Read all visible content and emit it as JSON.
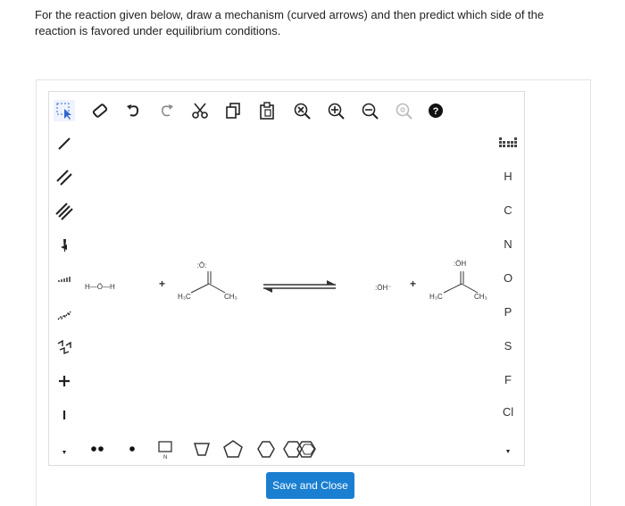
{
  "question": {
    "line1": "For the reaction given below, draw a mechanism (curved arrows) and then predict which side of the",
    "line2": "reaction is favored under equilibrium conditions."
  },
  "toolbar_top": [
    "select-icon",
    "eraser-icon",
    "undo-icon",
    "redo-icon",
    "cut-icon",
    "copy-icon",
    "paste-icon",
    "zoom-fit-icon",
    "zoom-in-icon",
    "zoom-out-icon",
    "zoom-reset-icon",
    "help-icon"
  ],
  "toolbar_left": [
    "single-bond-icon",
    "double-bond-icon",
    "triple-bond-icon",
    "wedge-bond-icon",
    "hash-bond-icon",
    "wavy-bond-icon",
    "chain-icon",
    "positive-charge-icon",
    "negative-charge-icon",
    "more-icon"
  ],
  "elements": [
    "H",
    "C",
    "N",
    "O",
    "P",
    "S",
    "F",
    "Cl"
  ],
  "periodic_table_icon": "periodic-table-icon",
  "bottom_tools": [
    "lone-pair-icon",
    "radical-icon",
    "template-icon",
    "cyclopropane-icon",
    "cyclopentane-icon",
    "cyclohexane-icon",
    "benzene-icon"
  ],
  "reaction": {
    "water_label": "H—Ö—H",
    "plus1": "+",
    "ketone_left_me": "H₃C",
    "ketone_right_me": "CH₃",
    "ketone_o": ":Ö:",
    "hydroxide": ":ÖH⁻",
    "plus2": "+",
    "product_oh": ":ÖH",
    "product_left_me": "H₃C",
    "product_right_me": "CH₃"
  },
  "save_button": "Save and Close",
  "colors": {
    "accent": "#1a7fd1",
    "border": "#dcdcdc"
  }
}
